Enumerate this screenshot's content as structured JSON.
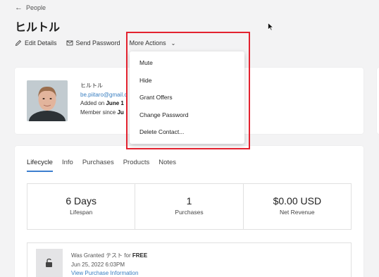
{
  "breadcrumb": {
    "label": "People"
  },
  "page": {
    "title": "ヒルトル"
  },
  "toolbar": {
    "edit": "Edit Details",
    "send": "Send Password",
    "more": "More Actions"
  },
  "profile": {
    "name": "ヒルトル",
    "email": "be.piitaro@gmail.c",
    "added_prefix": "Added on ",
    "added_value": "June 1",
    "member_prefix": "Member since ",
    "member_value": "Ju"
  },
  "tabs": [
    "Lifecycle",
    "Info",
    "Purchases",
    "Products",
    "Notes"
  ],
  "stats": [
    {
      "value": "6 Days",
      "label": "Lifespan"
    },
    {
      "value": "1",
      "label": "Purchases"
    },
    {
      "value": "$0.00 USD",
      "label": "Net Revenue"
    }
  ],
  "purchase": {
    "granted_prefix": "Was Granted ",
    "product": "テスト",
    "for_text": " for ",
    "price": "FREE",
    "date": "Jun 25, 2022 6:03PM",
    "link": "View Purchase Information"
  },
  "menu": {
    "items": [
      "Mute",
      "Hide",
      "Grant Offers",
      "Change Password",
      "Delete Contact..."
    ]
  },
  "colors": {
    "accent": "#3d7fcf",
    "highlight": "#e3222f",
    "link": "#3a7fc1"
  }
}
